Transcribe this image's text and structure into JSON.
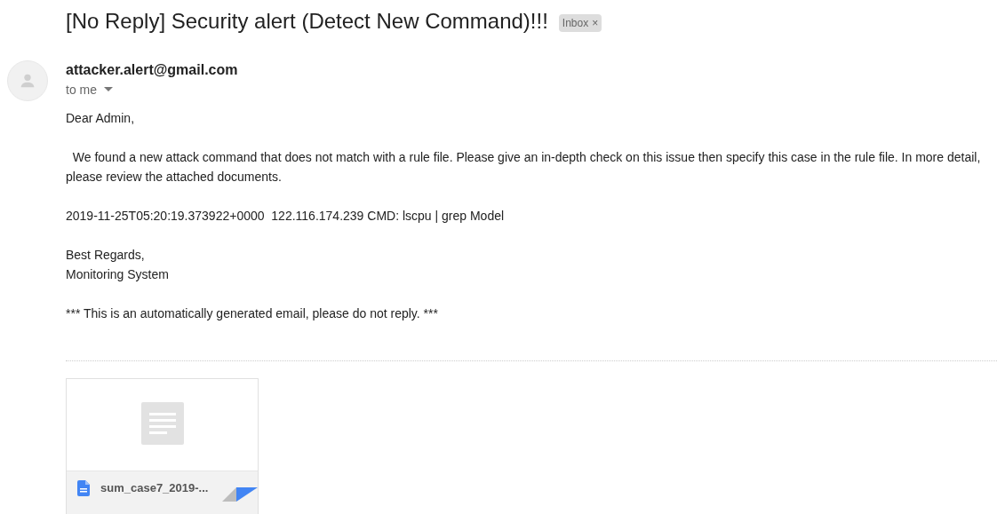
{
  "subject": "[No Reply] Security alert (Detect New Command)!!!",
  "label": {
    "text": "Inbox",
    "close": "×"
  },
  "sender": "attacker.alert@gmail.com",
  "recipient": "to me",
  "body": [
    {
      "kind": "paragraph",
      "text": "Dear Admin,"
    },
    {
      "kind": "paragraph",
      "text": "  We found a new attack command that does not match with a rule file. Please give an in-depth check on this issue then specify this case in the rule file. In more detail, please review the attached documents."
    },
    {
      "kind": "paragraph",
      "text": "2019-11-25T05:20:19.373922+0000  122.116.174.239 CMD: lscpu | grep Model"
    },
    {
      "kind": "lines",
      "lines": [
        "Best Regards,",
        "Monitoring System"
      ]
    },
    {
      "kind": "paragraph",
      "text": "*** This is an automatically generated email, please do not reply. ***"
    }
  ],
  "attachment": {
    "name": "sum_case7_2019-..."
  }
}
